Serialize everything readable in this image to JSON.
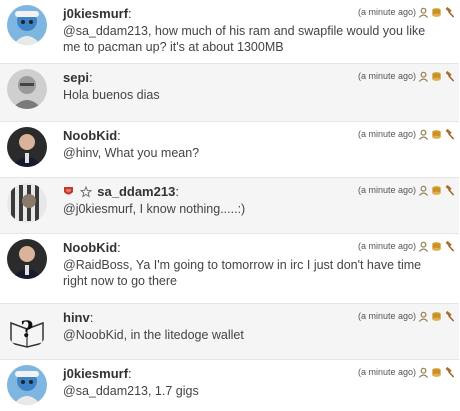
{
  "messages": [
    {
      "author": "j0kiesmurf",
      "time": "(a minute ago)",
      "text": "@sa_ddam213,  how much of his ram and swapfile would you like me to pacman up? it's at about 1300MB"
    },
    {
      "author": "sepi",
      "time": "(a minute ago)",
      "text": "Hola buenos dias"
    },
    {
      "author": "NoobKid",
      "time": "(a minute ago)",
      "text": "@hinv, What you mean?"
    },
    {
      "author": "sa_ddam213",
      "time": "(a minute ago)",
      "text": "@j0kiesmurf, I know nothing.....:)"
    },
    {
      "author": "NoobKid",
      "time": "(a minute ago)",
      "text": "@RaidBoss, Ya I'm going to tomorrow in irc I just don't have time right now to go there"
    },
    {
      "author": "hinv",
      "time": "(a minute ago)",
      "text": "@NoobKid, in the litedoge wallet"
    },
    {
      "author": "j0kiesmurf",
      "time": "(a minute ago)",
      "text": "@sa_ddam213,  1.7 gigs"
    }
  ],
  "colon": ":",
  "icons": [
    "user-icon",
    "coins-icon",
    "gavel-icon"
  ],
  "colors": {
    "row_alt": "#f5f5f5",
    "divider": "#e6e6e6"
  }
}
